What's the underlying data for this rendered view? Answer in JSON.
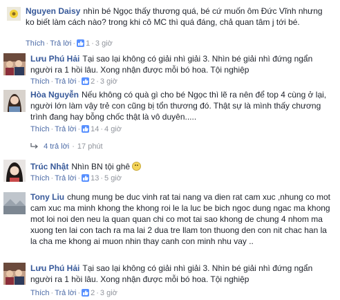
{
  "comments": [
    {
      "author": "Nguyen Daisy",
      "text": "nhìn bé Ngọc thấy thương quá, bé cứ muốn ôm Đức Vĩnh nhưng ko biết làm cách nào? trong khi cô MC thì quá đáng, chả quan tâm j tới bé.",
      "like_label": "Thích",
      "reply_label": "Trả lời",
      "likes": "1",
      "time": "3 giờ"
    },
    {
      "author": "Lưu Phú Hải",
      "text": "Tại sao lại không có giải nhì giải 3. Nhìn bé giải nhì đứng ngẩn người ra 1 hồi lâu. Xong nhận được mỗi bó hoa. Tội nghiệp",
      "like_label": "Thích",
      "reply_label": "Trả lời",
      "likes": "2",
      "time": "3 giờ"
    },
    {
      "author": "Hòa Nguyễn",
      "text": "Nếu không có quà gì cho bé Ngọc thì lẽ ra nên để top 4 cùng ở lại, người lớn làm vậy trẻ con cũng bị tổn thương đó. Thật sự là mình thấy chương trình đang hay bỗng chốc thật là vô duyên.....",
      "like_label": "Thích",
      "reply_label": "Trả lời",
      "likes": "14",
      "time": "4 giờ"
    },
    {
      "author": "Trúc Nhật",
      "text": "Nhìn BN tội ghê",
      "like_label": "Thích",
      "reply_label": "Trả lời",
      "likes": "13",
      "time": "5 giờ"
    },
    {
      "author": "Tony Liu",
      "text": "chung mung be duc vinh rat tai nang va dien rat cam xuc ,nhung co mot cam xuc ma minh khong the khong roi le la luc be bich ngoc dung ngac ma khong mot loi noi den neu la quan quan chi co mot tai sao khong de chung 4 nhom ma xuong ten lai con tach ra ma lai 2 dua tre llam ton thuong den con nit chac han la la cha me khong ai muon nhin thay canh con minh nhu vay ..",
      "like_label": "Thích",
      "reply_label": "Trả lời",
      "likes": "",
      "time": ""
    },
    {
      "author": "Lưu Phú Hải",
      "text": "Tại sao lại không có giải nhì giải 3. Nhìn bé giải nhì đứng ngẩn người ra 1 hồi lâu. Xong nhận được mỗi bó hoa. Tội nghiệp",
      "like_label": "Thích",
      "reply_label": "Trả lời",
      "likes": "2",
      "time": "3 giờ"
    }
  ],
  "replies_row": {
    "label": "4 trả lời",
    "time": "17 phút"
  }
}
